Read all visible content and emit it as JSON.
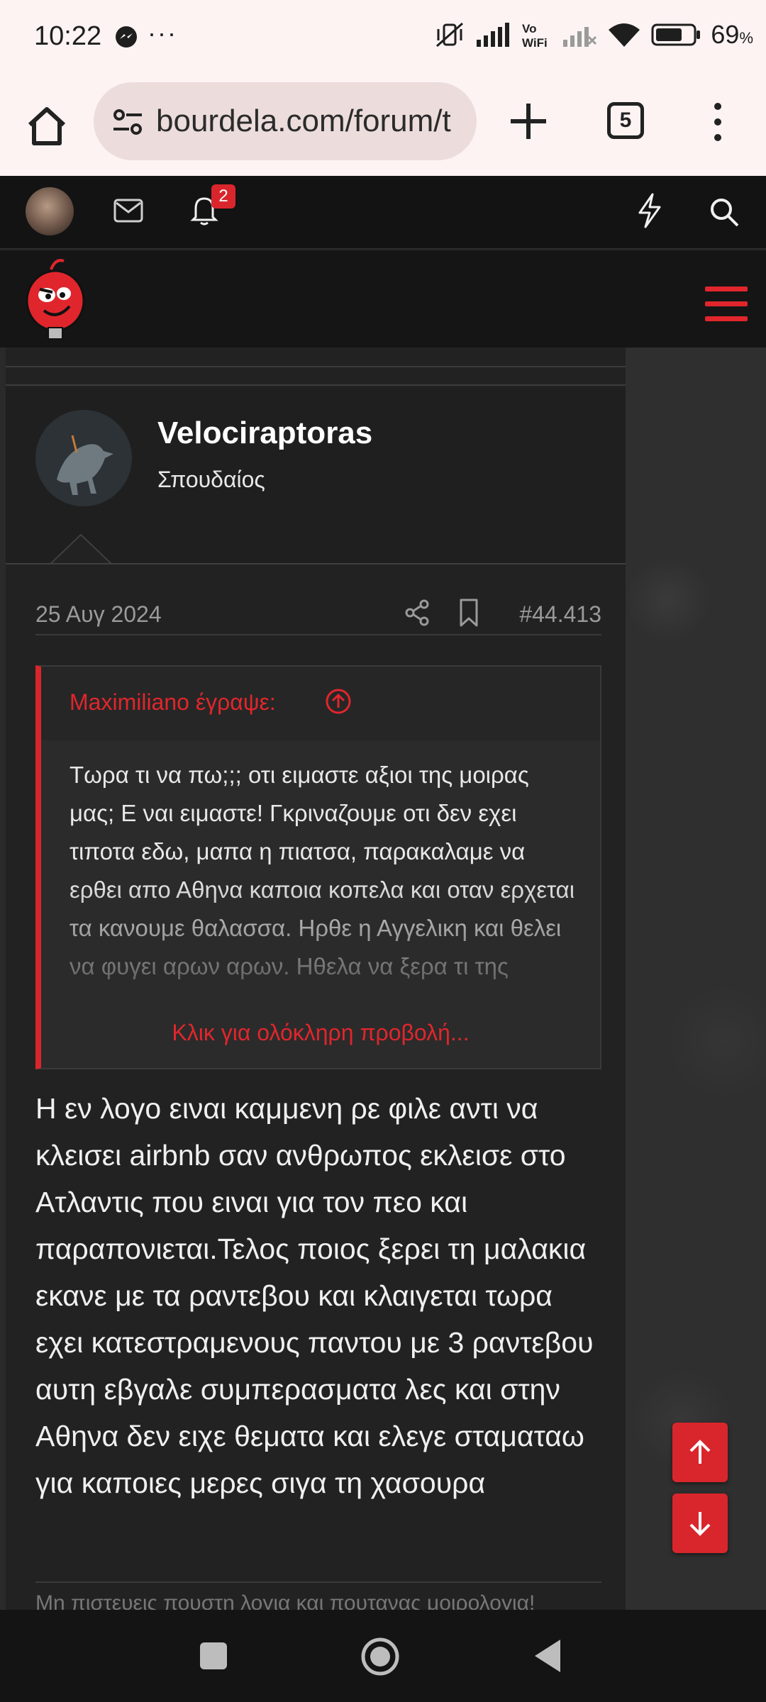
{
  "status_bar": {
    "time": "10:22",
    "dots": "···",
    "battery_percent": "69",
    "battery_unit": "%",
    "icons": [
      "messenger-icon",
      "mute-vibrate-icon",
      "signal-icon",
      "vowifi-icon",
      "signal-empty-icon",
      "wifi-icon",
      "battery-icon"
    ]
  },
  "browser": {
    "url": "bourdela.com/forum/t",
    "tab_count": "5"
  },
  "site_top": {
    "notification_count": "2"
  },
  "post": {
    "username": "Velociraptoras",
    "user_title": "Σπουδαίος",
    "date": "25 Αυγ 2024",
    "post_number": "#44.413",
    "quote": {
      "author": "Maximiliano έγραψε:",
      "text": "Τωρα τι να πω;;; οτι ειμαστε αξιοι της μοιρας μας; Ε ναι ειμαστε! Γκριναζουμε οτι δεν εχει τιποτα εδω, μαπα η πιατσα, παρακαλαμε να ερθει απο Αθηνα καποια κοπελα και οταν ερχεται τα κανουμε θαλασσα. Ηρθε η Αγγελικη και θελει να φυγει αρων αρων. Ηθελα να ξερα τι της",
      "expand_label": "Κλικ για ολόκληρη προβολή..."
    },
    "body": "Η εν λογο ειναι καμμενη ρε φιλε αντι να κλεισει airbnb σαν ανθρωπος εκλεισε στο Ατλαντις που ειναι για τον πεο και παραπονιεται.Τελος ποιος ξερει τη μαλακια εκανε με τα ραντεβου και κλαιγεται τωρα εχει κατεστραμενους παντου με 3 ραντεβου αυτη εβγαλε συμπερασματα λες και στην Αθηνα δεν ειχε θεματα και ελεγε σταματαω για καποιες μερες σιγα τη χασουρα",
    "signature": "Μη πιστευεις πουστη λογια και πουτανας μοιρολογια!"
  },
  "colors": {
    "accent": "#d9262c",
    "page_bg": "#1b1b1b",
    "post_bg": "#222222",
    "chrome_bg": "#fdf3f3"
  }
}
